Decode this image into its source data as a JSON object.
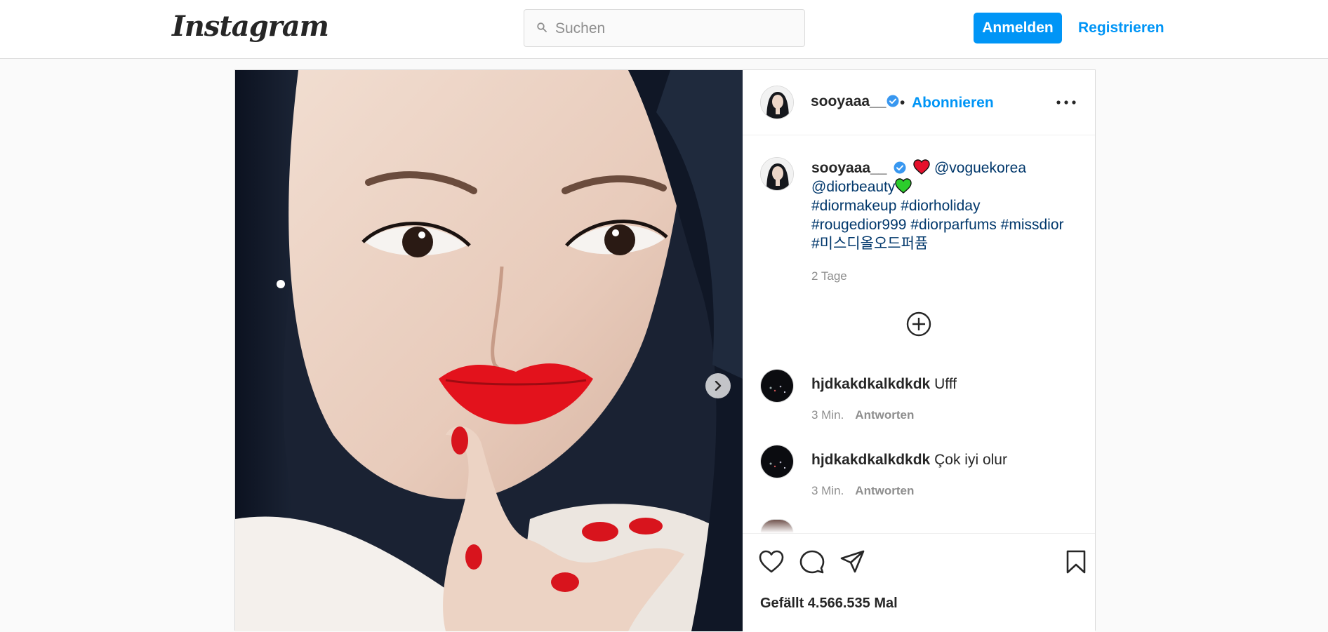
{
  "nav": {
    "logo_text": "Instagram",
    "search_placeholder": "Suchen",
    "login_label": "Anmelden",
    "signup_label": "Registrieren"
  },
  "post": {
    "author": "sooyaaa__",
    "follow_label": "Abonnieren",
    "separator": "•",
    "caption": {
      "mention1": "@voguekorea",
      "mention2": "@diorbeauty",
      "hashtags_line1": "#diormakeup #diorholiday",
      "hashtags_line2": "#rougedior999 #diorparfums #missdior",
      "hashtags_line3": "#미스디올오드퍼퓸"
    },
    "time_ago": "2 Tage",
    "comments": [
      {
        "user": "hjdkakdkalkdkdk",
        "text": "Ufff",
        "time": "3 Min.",
        "reply_label": "Antworten"
      },
      {
        "user": "hjdkakdkalkdkdk",
        "text": "Çok iyi olur",
        "time": "3 Min.",
        "reply_label": "Antworten"
      }
    ],
    "likes_text": "Gefällt 4.566.535 Mal"
  },
  "colors": {
    "accent": "#0095f6",
    "link_dark": "#00376b",
    "muted": "#8e8e8e",
    "border": "#dbdbdb",
    "lip_red": "#e3121c"
  },
  "icons": [
    "search-icon",
    "verified-badge-icon",
    "more-options-icon",
    "add-comment-icon",
    "heart-icon",
    "comment-icon",
    "share-icon",
    "bookmark-icon",
    "chevron-right-icon"
  ]
}
